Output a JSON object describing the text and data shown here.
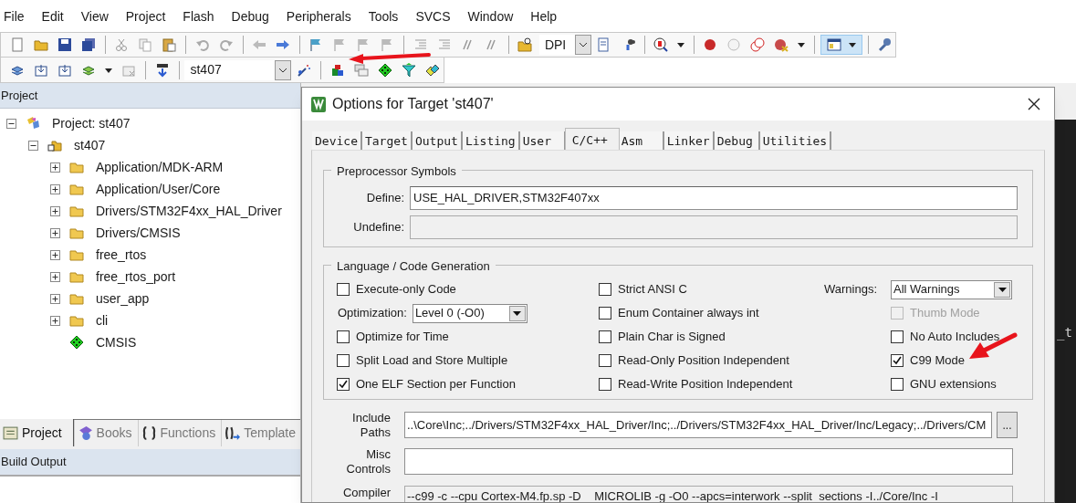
{
  "menu": [
    "File",
    "Edit",
    "View",
    "Project",
    "Flash",
    "Debug",
    "Peripherals",
    "Tools",
    "SVCS",
    "Window",
    "Help"
  ],
  "toolbar_1": {
    "find_combo": "DPI"
  },
  "toolbar_2": {
    "target_combo": "st407"
  },
  "project_panel": {
    "title": "Project",
    "tree": [
      {
        "label": "Project: st407",
        "kind": "project",
        "expanded": true,
        "children": [
          {
            "label": "st407",
            "kind": "target",
            "expanded": true,
            "children": [
              {
                "label": "Application/MDK-ARM",
                "kind": "folder",
                "expanded": false
              },
              {
                "label": "Application/User/Core",
                "kind": "folder",
                "expanded": false
              },
              {
                "label": "Drivers/STM32F4xx_HAL_Driver",
                "kind": "folder",
                "expanded": false
              },
              {
                "label": "Drivers/CMSIS",
                "kind": "folder",
                "expanded": false
              },
              {
                "label": "free_rtos",
                "kind": "folder",
                "expanded": false
              },
              {
                "label": "free_rtos_port",
                "kind": "folder",
                "expanded": false
              },
              {
                "label": "user_app",
                "kind": "folder",
                "expanded": false
              },
              {
                "label": "cli",
                "kind": "folder",
                "expanded": false
              },
              {
                "label": "CMSIS",
                "kind": "component"
              }
            ]
          }
        ]
      }
    ]
  },
  "panel_tabs": [
    {
      "label": "Project",
      "kind": "project",
      "selected": true
    },
    {
      "label": "Books",
      "kind": "books",
      "selected": false
    },
    {
      "label": "Functions",
      "kind": "functions",
      "selected": false
    },
    {
      "label": "Template",
      "kind": "templates",
      "selected": false
    }
  ],
  "build_output": {
    "title": "Build Output"
  },
  "editor": {
    "text": "_t"
  },
  "dialog": {
    "title": "Options for Target 'st407'",
    "tabs": [
      {
        "label": "Device",
        "selected": false
      },
      {
        "label": "Target",
        "selected": false
      },
      {
        "label": "Output",
        "selected": false
      },
      {
        "label": "Listing",
        "selected": false
      },
      {
        "label": "User",
        "selected": false
      },
      {
        "label": "C/C++",
        "selected": true
      },
      {
        "label": "Asm",
        "selected": false
      },
      {
        "label": "Linker",
        "selected": false
      },
      {
        "label": "Debug",
        "selected": false
      },
      {
        "label": "Utilities",
        "selected": false
      }
    ],
    "preprocessor": {
      "title": "Preprocessor Symbols",
      "define_label": "Define:",
      "define_value": "USE_HAL_DRIVER,STM32F407xx",
      "undefine_label": "Undefine:"
    },
    "language": {
      "title": "Language / Code Generation",
      "columns": [
        [
          {
            "kind": "checkbox",
            "label": "Execute-only Code",
            "checked": false,
            "disabled": false
          },
          {
            "kind": "select",
            "label": "Optimization:",
            "value": "Level 0 (-O0)"
          },
          {
            "kind": "checkbox",
            "label": "Optimize for Time",
            "checked": false,
            "disabled": false
          },
          {
            "kind": "checkbox",
            "label": "Split Load and Store Multiple",
            "checked": false,
            "disabled": false
          },
          {
            "kind": "checkbox",
            "label": "One ELF Section per Function",
            "checked": true,
            "disabled": false
          }
        ],
        [
          {
            "kind": "checkbox",
            "label": "Strict ANSI C",
            "checked": false,
            "disabled": false
          },
          {
            "kind": "checkbox",
            "label": "Enum Container always int",
            "checked": false,
            "disabled": false
          },
          {
            "kind": "checkbox",
            "label": "Plain Char is Signed",
            "checked": false,
            "disabled": false
          },
          {
            "kind": "checkbox",
            "label": "Read-Only Position Independent",
            "checked": false,
            "disabled": false
          },
          {
            "kind": "checkbox",
            "label": "Read-Write Position Independent",
            "checked": false,
            "disabled": false
          }
        ],
        [
          {
            "kind": "select",
            "label": "Warnings:",
            "value": "All Warnings"
          },
          {
            "kind": "checkbox",
            "label": "Thumb Mode",
            "checked": false,
            "disabled": true
          },
          {
            "kind": "checkbox",
            "label": "No Auto Includes",
            "checked": false,
            "disabled": false
          },
          {
            "kind": "checkbox",
            "label": "C99 Mode",
            "checked": true,
            "disabled": false
          },
          {
            "kind": "checkbox",
            "label": "GNU extensions",
            "checked": false,
            "disabled": false
          }
        ]
      ]
    },
    "include_paths": {
      "label": "Include Paths",
      "value": "..\\Core\\Inc;../Drivers/STM32F4xx_HAL_Driver/Inc;../Drivers/STM32F4xx_HAL_Driver/Inc/Legacy;../Drivers/CM",
      "button": "..."
    },
    "misc_controls": {
      "label": "Misc Controls"
    },
    "compiler": {
      "label": "Compiler",
      "value": "--c99 -c --cpu Cortex-M4.fp.sp -D__MICROLIB -g -O0 --apcs=interwork --split_sections -I../Core/Inc -I"
    }
  }
}
